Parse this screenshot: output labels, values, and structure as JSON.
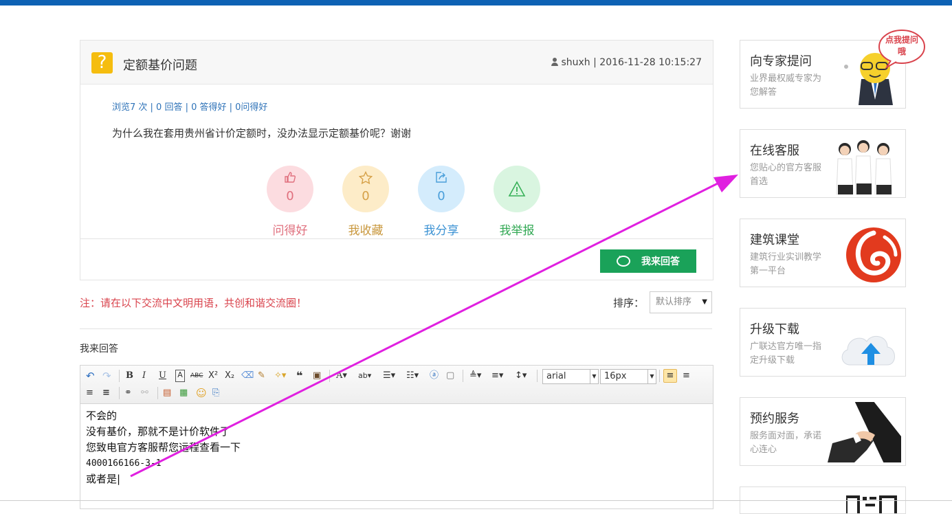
{
  "question": {
    "icon": "?",
    "title": "定额基价问题",
    "user": "shuxh",
    "separator": "|",
    "datetime": "2016-11-28 10:15:27",
    "stats": "浏览7 次 | 0 回答 | 0 答得好 | 0问得好",
    "body": "为什么我在套用贵州省计价定额时，没办法显示定额基价呢？谢谢"
  },
  "actions": [
    {
      "label": "问得好",
      "count": "0",
      "icon": "thumbs-up-icon"
    },
    {
      "label": "我收藏",
      "count": "0",
      "icon": "star-icon"
    },
    {
      "label": "我分享",
      "count": "0",
      "icon": "share-icon"
    },
    {
      "label": "我举报",
      "count": "",
      "icon": "warning-icon"
    }
  ],
  "answer_button": "我来回答",
  "notice": "注：请在以下交流中文明用语，共创和谐交流圈！",
  "sort": {
    "label": "排序：",
    "value": "默认排序"
  },
  "reply_label": "我来回答",
  "editor": {
    "font_family": "arial",
    "font_size": "16px",
    "lines": [
      "不会的",
      "没有基价，那就不是计价软件了",
      "您致电官方客服帮您远程查看一下",
      "4000166166-3-1",
      "或者是|"
    ]
  },
  "sidebar": [
    {
      "title": "向专家提问",
      "desc": "业界最权威专家为您解答",
      "bubble": "点我提问哦",
      "icon": "expert-mascot-icon"
    },
    {
      "title": "在线客服",
      "desc": "您贴心的官方客服首选",
      "icon": "service-staff-icon"
    },
    {
      "title": "建筑课堂",
      "desc": "建筑行业实训教学第一平台",
      "icon": "classroom-logo-icon"
    },
    {
      "title": "升级下载",
      "desc": "广联达官方唯一指定升级下载",
      "icon": "cloud-upload-icon"
    },
    {
      "title": "预约服务",
      "desc": "服务面对面，承诺心连心",
      "icon": "handshake-icon"
    }
  ],
  "colors": {
    "accent_blue": "#0d62b4",
    "green": "#1aa259",
    "red": "#d9434c",
    "arrow": "#e020e0"
  }
}
